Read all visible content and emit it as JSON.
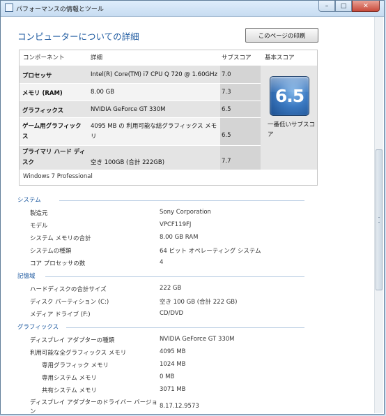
{
  "window": {
    "title": "パフォーマンスの情報とツール"
  },
  "header": {
    "title": "コンピューターについての詳細",
    "print_button": "このページの印刷"
  },
  "score_table": {
    "headers": {
      "component": "コンポーネント",
      "details": "詳細",
      "subscore": "サブスコア",
      "base_score": "基本スコア"
    },
    "rows": [
      {
        "component": "プロセッサ",
        "details": "Intel(R) Core(TM) i7 CPU Q 720 @ 1.60GHz",
        "subscore": "7.0"
      },
      {
        "component": "メモリ (RAM)",
        "details": "8.00 GB",
        "subscore": "7.3"
      },
      {
        "component": "グラフィックス",
        "details": "NVIDIA GeForce GT 330M",
        "subscore": "6.5"
      },
      {
        "component": "ゲーム用グラフィックス",
        "details": "4095 MB の 利用可能な総グラフィックス メモリ",
        "subscore": "6.5"
      },
      {
        "component": "プライマリ ハード ディスク",
        "details": "空き 100GB (合計 222GB)",
        "subscore": "7.7"
      }
    ],
    "base_score": {
      "value": "6.5",
      "caption": "一番低いサブスコア"
    },
    "os": "Windows 7 Professional"
  },
  "sections": {
    "system": {
      "title": "システム",
      "items": [
        {
          "label": "製造元",
          "value": "Sony Corporation"
        },
        {
          "label": "モデル",
          "value": "VPCF119FJ"
        },
        {
          "label": "システム メモリの合計",
          "value": "8.00 GB RAM"
        },
        {
          "label": "システムの種類",
          "value": "64 ビット オペレーティング システム"
        },
        {
          "label": "コア プロセッサの数",
          "value": "4"
        }
      ]
    },
    "storage": {
      "title": "記憶域",
      "items": [
        {
          "label": "ハードディスクの合計サイズ",
          "value": "222 GB"
        },
        {
          "label": "ディスク パーティション (C:)",
          "value": "空き 100 GB (合計 222 GB)"
        },
        {
          "label": "メディア ドライブ (F:)",
          "value": "CD/DVD"
        }
      ]
    },
    "graphics": {
      "title": "グラフィックス",
      "items": [
        {
          "label": "ディスプレイ アダプターの種類",
          "value": "NVIDIA GeForce GT 330M"
        },
        {
          "label": "利用可能な全グラフィックス メモリ",
          "value": "4095 MB"
        },
        {
          "label": "専用グラフィック メモリ",
          "value": "1024 MB"
        },
        {
          "label": "専用システム メモリ",
          "value": "0 MB"
        },
        {
          "label": "共有システム メモリ",
          "value": "3071 MB"
        },
        {
          "label": "ディスプレイ アダプターのドライバー バージョン",
          "value": "8.17.12.9573"
        }
      ]
    }
  }
}
